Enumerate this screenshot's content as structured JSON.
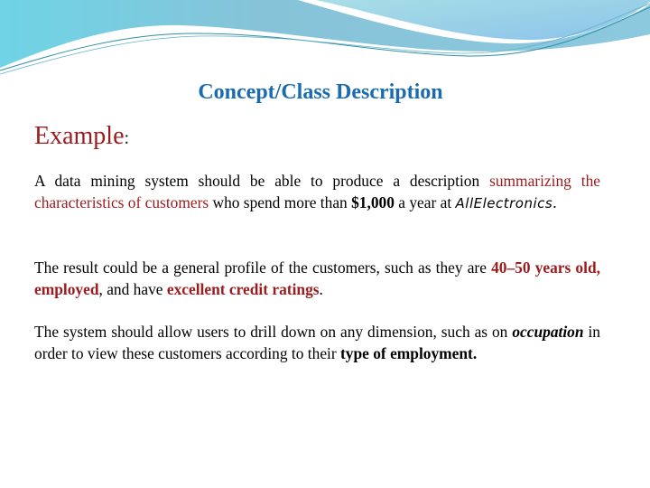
{
  "slide": {
    "title": "Concept/Class Description",
    "subtitle": "Example",
    "subtitle_colon": ":",
    "colors": {
      "title": "#1a6cae",
      "accent_red": "#9b1c1f",
      "header_blue": "#7fc6dc"
    },
    "paragraph1": {
      "t1": "A data mining system should be able to produce a description ",
      "t2": "summarizing the characteristics of customers",
      "t3": " who spend more than ",
      "t4": "$1,000",
      "t5": " a year at ",
      "t6": "AllElectronics",
      "t7": "."
    },
    "paragraph2": {
      "t1": "The result could be a general profile of the customers, such as they are ",
      "t2": "40–50 years old, employed",
      "t3": ", and have ",
      "t4": "excellent credit ratings",
      "t5": "."
    },
    "paragraph3": {
      "t1": "The system should allow users to drill down on any dimension, such as on ",
      "t2": "occupation",
      "t3": " in order to view these customers according to their ",
      "t4": "type of employment."
    }
  }
}
